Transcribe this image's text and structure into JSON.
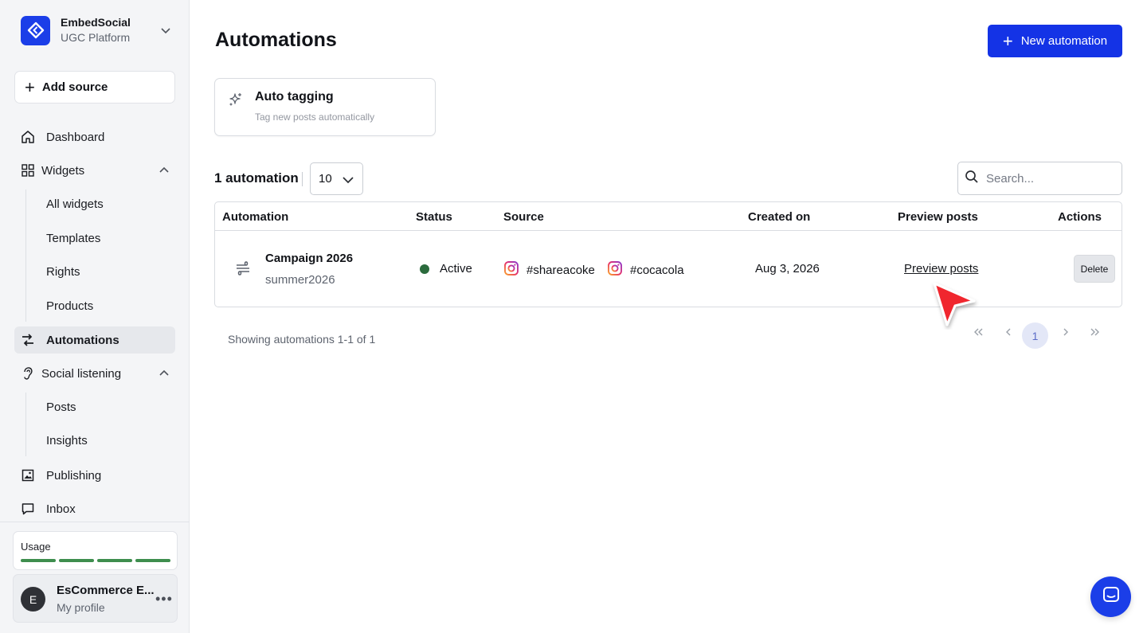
{
  "brand": {
    "name": "EmbedSocial",
    "subtitle": "UGC Platform"
  },
  "sidebar": {
    "add_source": "Add source",
    "dashboard": "Dashboard",
    "widgets": {
      "label": "Widgets",
      "items": [
        "All widgets",
        "Templates",
        "Rights",
        "Products"
      ]
    },
    "automations": "Automations",
    "social_listening": {
      "label": "Social listening",
      "items": [
        "Posts",
        "Insights"
      ]
    },
    "publishing": "Publishing",
    "inbox": "Inbox",
    "usage": {
      "label": "Usage"
    },
    "profile": {
      "initial": "E",
      "name": "EsCommerce E...",
      "sub": "My profile"
    }
  },
  "header": {
    "title": "Automations",
    "new_button": "New automation"
  },
  "auto_tagging": {
    "title": "Auto tagging",
    "subtitle": "Tag new posts automatically"
  },
  "toolbar": {
    "count_label": "1 automation",
    "page_size": "10",
    "search_placeholder": "Search..."
  },
  "table": {
    "columns": [
      "Automation",
      "Status",
      "Source",
      "Created on",
      "Preview posts",
      "Actions"
    ],
    "rows": [
      {
        "name": "Campaign 2026",
        "tag": "summer2026",
        "status": "Active",
        "sources": [
          "#shareacoke",
          "#cocacola"
        ],
        "created": "Aug 3, 2026",
        "preview": "Preview posts",
        "action": "Delete"
      }
    ]
  },
  "pagination": {
    "showing": "Showing automations 1-1 of 1",
    "current": "1"
  },
  "colors": {
    "accent": "#1433e6",
    "active_status": "#2b6b3d",
    "usage_bar": "#3e8e4e",
    "cursor": "#f0262e"
  }
}
